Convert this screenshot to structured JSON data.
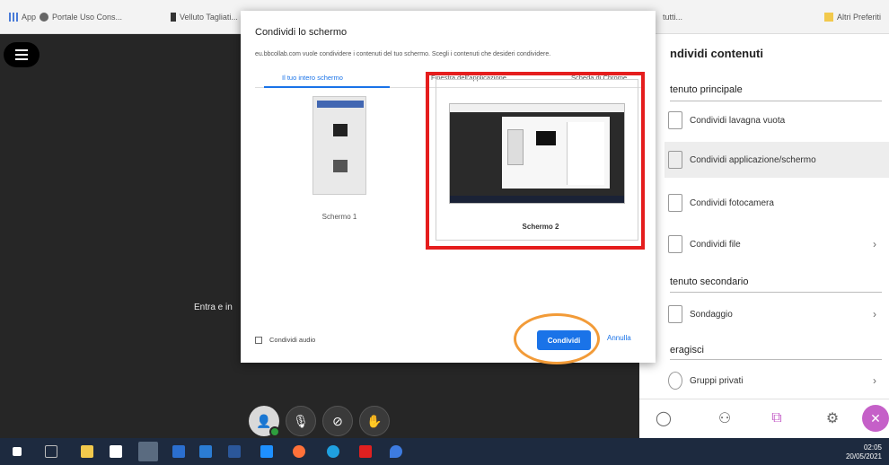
{
  "bookmarks": {
    "items": [
      {
        "label": "App"
      },
      {
        "label": "Portale Uso Cons..."
      },
      {
        "label": "Velluto Tagliati..."
      },
      {
        "label": "tutti..."
      },
      {
        "label": "Altri Preferiti"
      }
    ]
  },
  "meeting": {
    "enter_text": "Entra e in",
    "controls": [
      "avatar",
      "microphone-off",
      "camera-off",
      "hand-raise"
    ]
  },
  "panel": {
    "title": "ndividi contenuti",
    "primary_heading": "tenuto principale",
    "items_primary": [
      {
        "label": "Condividi lavagna vuota"
      },
      {
        "label": "Condividi applicazione/schermo"
      },
      {
        "label": "Condividi fotocamera"
      },
      {
        "label": "Condividi file"
      }
    ],
    "secondary_heading": "tenuto secondario",
    "items_secondary": [
      {
        "label": "Sondaggio"
      }
    ],
    "tertiary_heading": "eragisci",
    "items_tertiary": [
      {
        "label": "Gruppi privati"
      }
    ]
  },
  "dialog": {
    "title": "Condividi lo schermo",
    "subtitle": "eu.bbcollab.com vuole condividere i contenuti del tuo schermo. Scegli i contenuti che desideri condividere.",
    "tabs": [
      "Il tuo intero schermo",
      "Finestra dell'applicazione",
      "Scheda di Chrome"
    ],
    "screens": [
      {
        "label": "Schermo 1"
      },
      {
        "label": "Schermo 2"
      }
    ],
    "audio_label": "Condividi audio",
    "share_label": "Condividi",
    "cancel_label": "Annulla"
  },
  "taskbar": {
    "clock_time": "02:05",
    "clock_date": "20/05/2021"
  },
  "colors": {
    "accent": "#1a73e8",
    "highlight_red": "#e51d1d",
    "highlight_orange": "#f29b38",
    "close_purple": "#c560c8"
  }
}
